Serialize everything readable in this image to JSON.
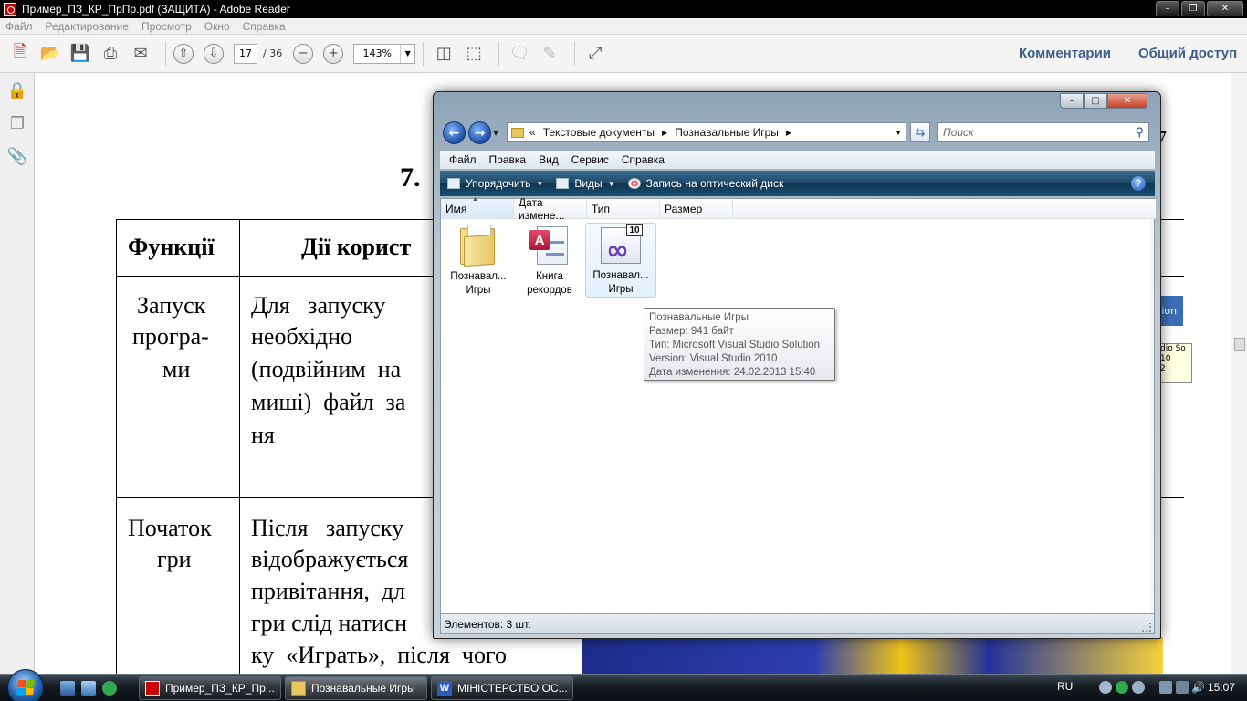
{
  "reader": {
    "title": "Пример_ПЗ_КР_ПрПр.pdf (ЗАЩИТА) - Adobe Reader",
    "menu": [
      "Файл",
      "Редактирование",
      "Просмотр",
      "Окно",
      "Справка"
    ],
    "toolbar": {
      "page_current": "17",
      "page_total": "/ 36",
      "zoom": "143%",
      "comments_label": "Комментарии",
      "share_label": "Общий доступ"
    },
    "document": {
      "heading_prefix": "7.",
      "table_header": [
        "Функції",
        "Дії корист"
      ],
      "row1_function": [
        "Запуск",
        "програ-",
        "ми"
      ],
      "row1_action": [
        "Для   запуску",
        "необхідно",
        "(подвійним  на",
        "миші)  файл  за",
        "ня"
      ],
      "row2_function": [
        "Початок",
        "гри"
      ],
      "row2_action": [
        "Після   запуску",
        "відображується",
        "привітання,  дл",
        "гри слід натисн",
        "ку  «Играть»,  після  чого"
      ],
      "peek_page_number": "7",
      "peek_blue_text": "tion",
      "peek_tip_lines": [
        "dio So",
        "10",
        "2"
      ]
    }
  },
  "explorer": {
    "address_segments": [
      "Текстовые документы",
      "Познавальные Игры"
    ],
    "address_prefix": "«",
    "search_placeholder": "Поиск",
    "menu": [
      "Файл",
      "Правка",
      "Вид",
      "Сервис",
      "Справка"
    ],
    "commands": {
      "organize": "Упорядочить",
      "views": "Виды",
      "burn": "Запись на оптический диск"
    },
    "columns": [
      "Имя",
      "Дата измене...",
      "Тип",
      "Размер"
    ],
    "files": [
      {
        "name": "Познавал... Игры",
        "line1": "Познавал...",
        "line2": "Игры",
        "icon": "folder-icon"
      },
      {
        "name": "Книга рекордов",
        "line1": "Книга",
        "line2": "рекордов",
        "icon": "access-db-icon"
      },
      {
        "name": "Познавал... Игры",
        "line1": "Познавал...",
        "line2": "Игры",
        "icon": "visual-studio-solution-icon"
      }
    ],
    "tooltip": [
      "Познавальные Игры",
      "Размер: 941 байт",
      "Тип: Microsoft Visual Studio Solution",
      "Version: Visual Studio 2010",
      "Дата изменения: 24.02.2013 15:40"
    ],
    "status": "Элементов: 3 шт."
  },
  "taskbar": {
    "buttons": [
      "Пример_ПЗ_КР_Пр...",
      "Познавальные Игры",
      "МІНІСТЕРСТВО ОС..."
    ],
    "language": "RU",
    "clock": "15:07"
  }
}
